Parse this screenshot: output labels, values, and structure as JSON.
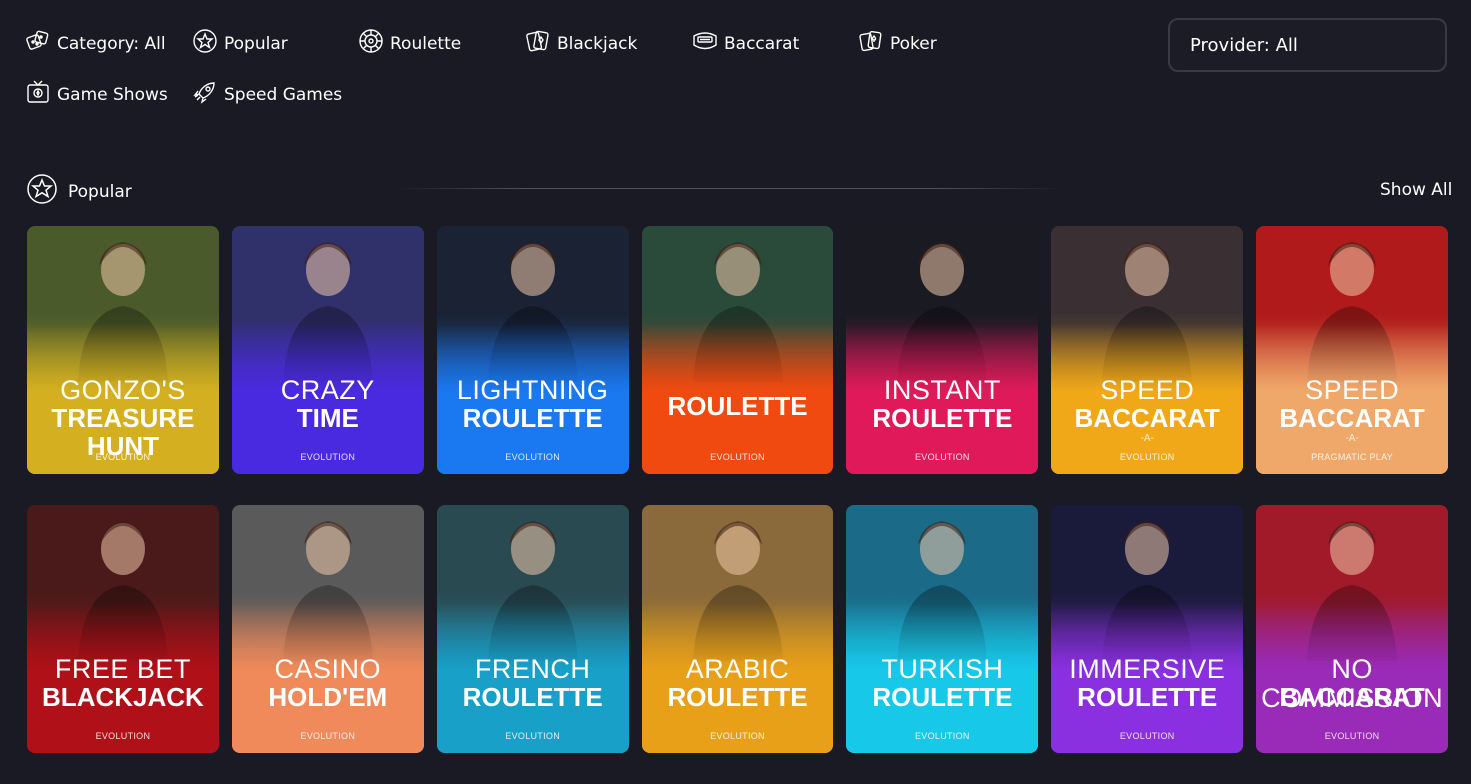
{
  "categories": [
    {
      "label": "Category: All",
      "icon": "dice-icon"
    },
    {
      "label": "Popular",
      "icon": "star-circle-icon"
    },
    {
      "label": "Roulette",
      "icon": "roulette-icon"
    },
    {
      "label": "Blackjack",
      "icon": "cards-icon"
    },
    {
      "label": "Baccarat",
      "icon": "baccarat-icon"
    },
    {
      "label": "Poker",
      "icon": "poker-icon"
    },
    {
      "label": "Game Shows",
      "icon": "tv-icon"
    },
    {
      "label": "Speed Games",
      "icon": "rocket-icon"
    }
  ],
  "provider": {
    "label": "Provider: All"
  },
  "section": {
    "title": "Popular",
    "show_all": "Show All"
  },
  "games": [
    {
      "line1": "Gonzo's",
      "line2": "Treasure Hunt",
      "sub": "",
      "provider": "EVOLUTION",
      "colors": [
        "#4a5a2a",
        "#d4b020"
      ]
    },
    {
      "line1": "Crazy",
      "line2": "Time",
      "sub": "",
      "provider": "EVOLUTION",
      "colors": [
        "#30306a",
        "#4a2ae0"
      ]
    },
    {
      "line1": "Lightning",
      "line2": "Roulette",
      "sub": "",
      "provider": "EVOLUTION",
      "colors": [
        "#1a2234",
        "#1a78f0"
      ]
    },
    {
      "line1": "",
      "line2": "Roulette",
      "sub": "",
      "provider": "EVOLUTION",
      "colors": [
        "#2a4a3a",
        "#f04a10"
      ]
    },
    {
      "line1": "Instant",
      "line2": "Roulette",
      "sub": "",
      "provider": "EVOLUTION",
      "colors": [
        "#1a1a22",
        "#e01a5a"
      ]
    },
    {
      "line1": "Speed",
      "line2": "Baccarat",
      "sub": "-A-",
      "provider": "EVOLUTION",
      "colors": [
        "#3a3034",
        "#f0a818"
      ]
    },
    {
      "line1": "Speed",
      "line2": "Baccarat",
      "sub": "-A-",
      "provider": "PRAGMATIC PLAY",
      "colors": [
        "#b01a1a",
        "#f0a86a"
      ]
    },
    {
      "line1": "Free Bet",
      "line2": "Blackjack",
      "sub": "",
      "provider": "EVOLUTION",
      "colors": [
        "#4a1a1a",
        "#b01018"
      ]
    },
    {
      "line1": "Casino",
      "line2": "Hold'em",
      "sub": "",
      "provider": "EVOLUTION",
      "colors": [
        "#5a5a5a",
        "#f08a5a"
      ]
    },
    {
      "line1": "French",
      "line2": "Roulette",
      "sub": "",
      "provider": "EVOLUTION",
      "colors": [
        "#2a4a52",
        "#18a0c8"
      ]
    },
    {
      "line1": "Arabic",
      "line2": "Roulette",
      "sub": "",
      "provider": "EVOLUTION",
      "colors": [
        "#8a6a3a",
        "#e8a018"
      ]
    },
    {
      "line1": "Turkish",
      "line2": "Roulette",
      "sub": "",
      "provider": "EVOLUTION",
      "colors": [
        "#1a6a88",
        "#18c8e8"
      ]
    },
    {
      "line1": "Immersive",
      "line2": "Roulette",
      "sub": "",
      "provider": "EVOLUTION",
      "colors": [
        "#1a1a3a",
        "#8a30e0"
      ]
    },
    {
      "line1": "No Commission",
      "line2": "Baccarat",
      "sub": "",
      "provider": "EVOLUTION",
      "colors": [
        "#a01a2a",
        "#9a2ab8"
      ]
    }
  ]
}
